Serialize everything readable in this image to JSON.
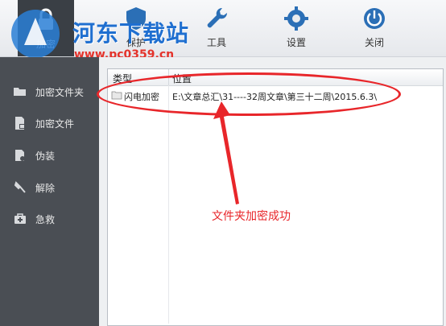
{
  "watermark": {
    "title": "河东下载站",
    "url": "www.pc0359.cn"
  },
  "toolbar": {
    "encrypt_label": "加密",
    "protect_label": "保护",
    "tools_label": "工具",
    "settings_label": "设置",
    "close_label": "关闭"
  },
  "sidebar": {
    "items": [
      {
        "label": "加密文件夹",
        "icon": "folder-open-icon"
      },
      {
        "label": "加密文件",
        "icon": "file-lock-icon"
      },
      {
        "label": "伪装",
        "icon": "mask-icon"
      },
      {
        "label": "解除",
        "icon": "unlock-icon"
      },
      {
        "label": "急救",
        "icon": "first-aid-icon"
      }
    ]
  },
  "list": {
    "columns": [
      "类型",
      "位置"
    ],
    "rows": [
      {
        "type": "闪电加密",
        "location": "E:\\文章总汇\\31----32周文章\\第三十二周\\2015.6.3\\"
      }
    ]
  },
  "annotation": {
    "text": "文件夹加密成功"
  },
  "colors": {
    "accent": "#1f6fd0",
    "annotation": "#e8262a",
    "sidebar": "#4a4e54"
  }
}
